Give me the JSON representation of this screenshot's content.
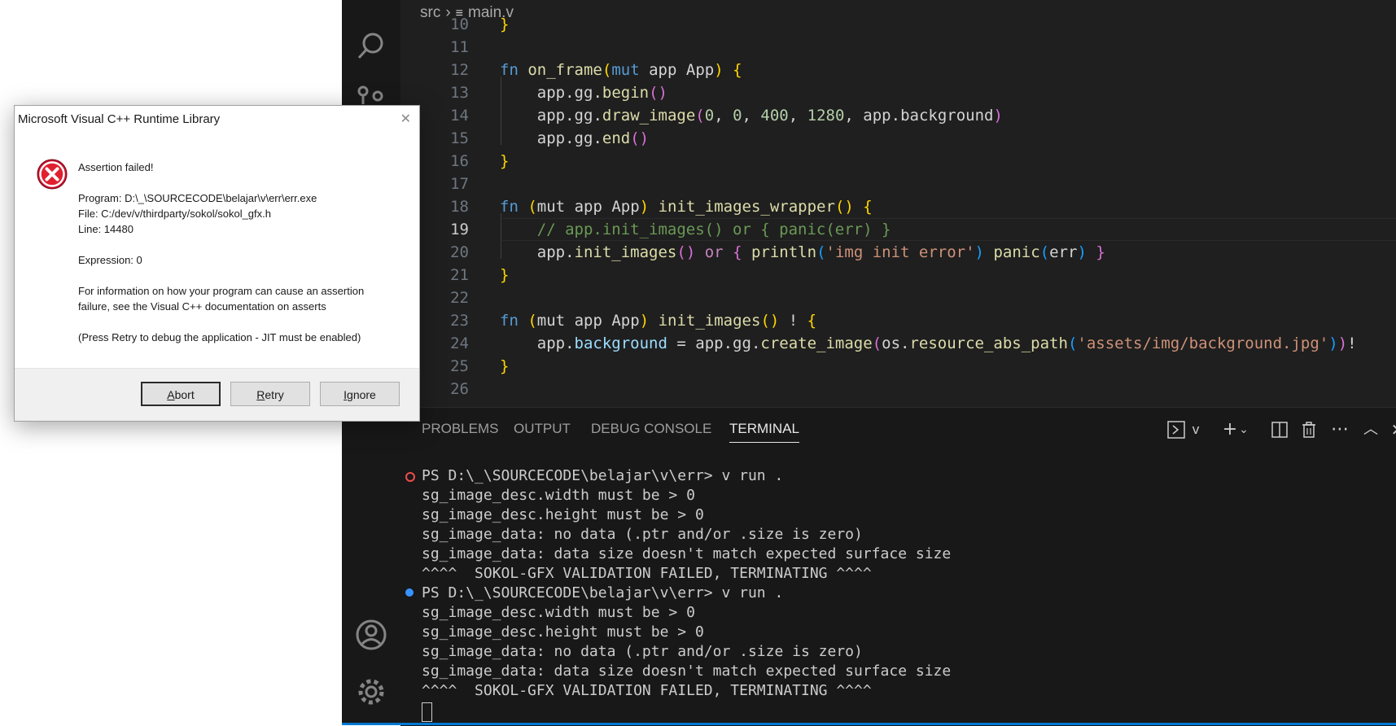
{
  "dialog": {
    "title": "Microsoft Visual C++ Runtime Library",
    "close": "✕",
    "lines": [
      "Assertion failed!",
      "Program: D:\\_\\SOURCECODE\\belajar\\v\\err\\err.exe",
      "File: C:/dev/v/thirdparty/sokol/sokol_gfx.h",
      "Line: 14480",
      "Expression: 0",
      "For information on how your program can cause an assertion",
      "failure, see the Visual C++ documentation on asserts",
      "(Press Retry to debug the application - JIT must be enabled)"
    ],
    "buttons": {
      "abort_first": "A",
      "abort_rest": "bort",
      "retry_first": "R",
      "retry_rest": "etry",
      "ignore_first": "I",
      "ignore_rest": "gnore"
    }
  },
  "breadcrumb": {
    "folder": "src",
    "file": "main.v"
  },
  "editor": {
    "line_numbers": [
      "10",
      "11",
      "12",
      "13",
      "14",
      "15",
      "16",
      "17",
      "18",
      "19",
      "20",
      "21",
      "22",
      "23",
      "24",
      "25",
      "26"
    ],
    "active_line": "19"
  },
  "panel": {
    "tabs": [
      "PROBLEMS",
      "OUTPUT",
      "DEBUG CONSOLE",
      "TERMINAL"
    ],
    "active_tab": "TERMINAL",
    "shell_label": "v"
  },
  "terminal": {
    "lines": [
      "PS D:\\_\\SOURCECODE\\belajar\\v\\err> v run .",
      "sg_image_desc.width must be > 0",
      "sg_image_desc.height must be > 0",
      "sg_image_data: no data (.ptr and/or .size is zero)",
      "sg_image_data: data size doesn't match expected surface size",
      "^^^^  SOKOL-GFX VALIDATION FAILED, TERMINATING ^^^^",
      "PS D:\\_\\SOURCECODE\\belajar\\v\\err> v run .",
      "sg_image_desc.width must be > 0",
      "sg_image_desc.height must be > 0",
      "sg_image_data: no data (.ptr and/or .size is zero)",
      "sg_image_data: data size doesn't match expected surface size",
      "^^^^  SOKOL-GFX VALIDATION FAILED, TERMINATING ^^^^"
    ]
  },
  "colors": {
    "accent": "#0078d4",
    "error": "#f14c4c",
    "success": "#3794ff"
  }
}
